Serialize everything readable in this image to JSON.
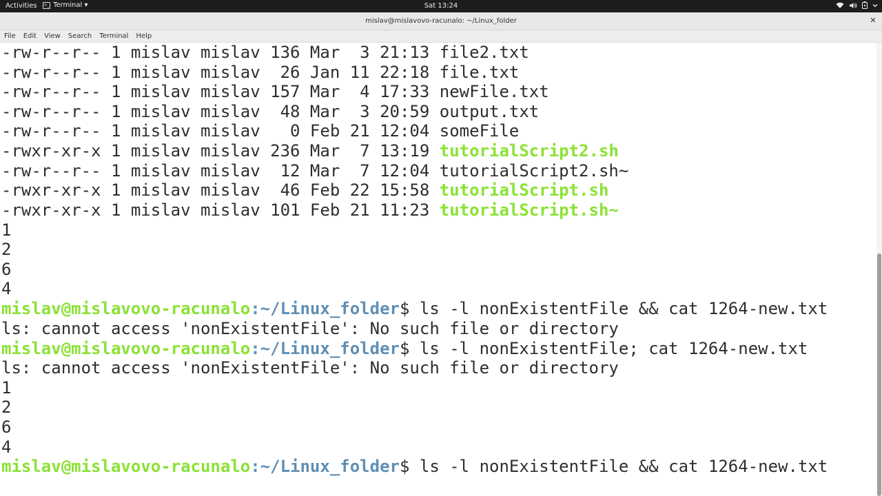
{
  "topbar": {
    "activities": "Activities",
    "app_name": "Terminal ▾",
    "clock": "Sat 13:24"
  },
  "window": {
    "title": "mislav@mislavovo-racunalo: ~/Linux_folder",
    "close": "✕"
  },
  "menubar": [
    "File",
    "Edit",
    "View",
    "Search",
    "Terminal",
    "Help"
  ],
  "colors": {
    "prompt_user": "#8ae234",
    "prompt_path": "#5f8fb5",
    "executable": "#8ae234",
    "text": "#2e2e2e"
  },
  "terminal": {
    "ls_rows": [
      {
        "meta": "-rw-r--r-- 1 mislav mislav 136 Mar  3 21:13 ",
        "name": "file2.txt",
        "exec": false
      },
      {
        "meta": "-rw-r--r-- 1 mislav mislav  26 Jan 11 22:18 ",
        "name": "file.txt",
        "exec": false
      },
      {
        "meta": "-rw-r--r-- 1 mislav mislav 157 Mar  4 17:33 ",
        "name": "newFile.txt",
        "exec": false
      },
      {
        "meta": "-rw-r--r-- 1 mislav mislav  48 Mar  3 20:59 ",
        "name": "output.txt",
        "exec": false
      },
      {
        "meta": "-rw-r--r-- 1 mislav mislav   0 Feb 21 12:04 ",
        "name": "someFile",
        "exec": false
      },
      {
        "meta": "-rwxr-xr-x 1 mislav mislav 236 Mar  7 13:19 ",
        "name": "tutorialScript2.sh",
        "exec": true
      },
      {
        "meta": "-rw-r--r-- 1 mislav mislav  12 Mar  7 12:04 ",
        "name": "tutorialScript2.sh~",
        "exec": false
      },
      {
        "meta": "-rwxr-xr-x 1 mislav mislav  46 Feb 22 15:58 ",
        "name": "tutorialScript.sh",
        "exec": true
      },
      {
        "meta": "-rwxr-xr-x 1 mislav mislav 101 Feb 21 11:23 ",
        "name": "tutorialScript.sh~",
        "exec": true
      }
    ],
    "output_block_1": [
      "1",
      "2",
      "6",
      "4"
    ],
    "prompt_1": {
      "user": "mislav@mislavovo-racunalo",
      "path": ":~/Linux_folder",
      "cmd": "$ ls -l nonExistentFile && cat 1264-new.txt"
    },
    "error_1": "ls: cannot access 'nonExistentFile': No such file or directory",
    "prompt_2": {
      "user": "mislav@mislavovo-racunalo",
      "path": ":~/Linux_folder",
      "cmd": "$ ls -l nonExistentFile; cat 1264-new.txt"
    },
    "error_2": "ls: cannot access 'nonExistentFile': No such file or directory",
    "output_block_2": [
      "1",
      "2",
      "6",
      "4"
    ],
    "prompt_3": {
      "user": "mislav@mislavovo-racunalo",
      "path": ":~/Linux_folder",
      "cmd": "$ ls -l nonExistentFile && cat 1264-new.txt"
    }
  }
}
